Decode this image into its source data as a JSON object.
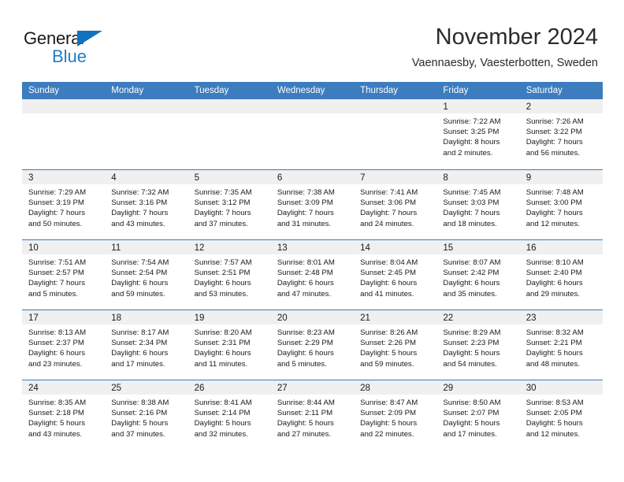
{
  "brand": {
    "word1": "General",
    "word2": "Blue",
    "triangle_color": "#1271bd",
    "word2_color": "#1f7ec4",
    "icon": "triangle-flag-logo"
  },
  "header": {
    "title": "November 2024",
    "subtitle": "Vaennaesby, Vaesterbotten, Sweden"
  },
  "theme": {
    "header_blue": "#3c7cbf",
    "day_band_gray": "#f0f0f0",
    "text_dark": "#1a1a1a"
  },
  "weekdays": [
    "Sunday",
    "Monday",
    "Tuesday",
    "Wednesday",
    "Thursday",
    "Friday",
    "Saturday"
  ],
  "weeks": [
    [
      {
        "day": "",
        "empty": true,
        "lines": []
      },
      {
        "day": "",
        "empty": true,
        "lines": []
      },
      {
        "day": "",
        "empty": true,
        "lines": []
      },
      {
        "day": "",
        "empty": true,
        "lines": []
      },
      {
        "day": "",
        "empty": true,
        "lines": []
      },
      {
        "day": "1",
        "empty": false,
        "lines": [
          "Sunrise: 7:22 AM",
          "Sunset: 3:25 PM",
          "Daylight: 8 hours",
          "and 2 minutes."
        ]
      },
      {
        "day": "2",
        "empty": false,
        "lines": [
          "Sunrise: 7:26 AM",
          "Sunset: 3:22 PM",
          "Daylight: 7 hours",
          "and 56 minutes."
        ]
      }
    ],
    [
      {
        "day": "3",
        "empty": false,
        "lines": [
          "Sunrise: 7:29 AM",
          "Sunset: 3:19 PM",
          "Daylight: 7 hours",
          "and 50 minutes."
        ]
      },
      {
        "day": "4",
        "empty": false,
        "lines": [
          "Sunrise: 7:32 AM",
          "Sunset: 3:16 PM",
          "Daylight: 7 hours",
          "and 43 minutes."
        ]
      },
      {
        "day": "5",
        "empty": false,
        "lines": [
          "Sunrise: 7:35 AM",
          "Sunset: 3:12 PM",
          "Daylight: 7 hours",
          "and 37 minutes."
        ]
      },
      {
        "day": "6",
        "empty": false,
        "lines": [
          "Sunrise: 7:38 AM",
          "Sunset: 3:09 PM",
          "Daylight: 7 hours",
          "and 31 minutes."
        ]
      },
      {
        "day": "7",
        "empty": false,
        "lines": [
          "Sunrise: 7:41 AM",
          "Sunset: 3:06 PM",
          "Daylight: 7 hours",
          "and 24 minutes."
        ]
      },
      {
        "day": "8",
        "empty": false,
        "lines": [
          "Sunrise: 7:45 AM",
          "Sunset: 3:03 PM",
          "Daylight: 7 hours",
          "and 18 minutes."
        ]
      },
      {
        "day": "9",
        "empty": false,
        "lines": [
          "Sunrise: 7:48 AM",
          "Sunset: 3:00 PM",
          "Daylight: 7 hours",
          "and 12 minutes."
        ]
      }
    ],
    [
      {
        "day": "10",
        "empty": false,
        "lines": [
          "Sunrise: 7:51 AM",
          "Sunset: 2:57 PM",
          "Daylight: 7 hours",
          "and 5 minutes."
        ]
      },
      {
        "day": "11",
        "empty": false,
        "lines": [
          "Sunrise: 7:54 AM",
          "Sunset: 2:54 PM",
          "Daylight: 6 hours",
          "and 59 minutes."
        ]
      },
      {
        "day": "12",
        "empty": false,
        "lines": [
          "Sunrise: 7:57 AM",
          "Sunset: 2:51 PM",
          "Daylight: 6 hours",
          "and 53 minutes."
        ]
      },
      {
        "day": "13",
        "empty": false,
        "lines": [
          "Sunrise: 8:01 AM",
          "Sunset: 2:48 PM",
          "Daylight: 6 hours",
          "and 47 minutes."
        ]
      },
      {
        "day": "14",
        "empty": false,
        "lines": [
          "Sunrise: 8:04 AM",
          "Sunset: 2:45 PM",
          "Daylight: 6 hours",
          "and 41 minutes."
        ]
      },
      {
        "day": "15",
        "empty": false,
        "lines": [
          "Sunrise: 8:07 AM",
          "Sunset: 2:42 PM",
          "Daylight: 6 hours",
          "and 35 minutes."
        ]
      },
      {
        "day": "16",
        "empty": false,
        "lines": [
          "Sunrise: 8:10 AM",
          "Sunset: 2:40 PM",
          "Daylight: 6 hours",
          "and 29 minutes."
        ]
      }
    ],
    [
      {
        "day": "17",
        "empty": false,
        "lines": [
          "Sunrise: 8:13 AM",
          "Sunset: 2:37 PM",
          "Daylight: 6 hours",
          "and 23 minutes."
        ]
      },
      {
        "day": "18",
        "empty": false,
        "lines": [
          "Sunrise: 8:17 AM",
          "Sunset: 2:34 PM",
          "Daylight: 6 hours",
          "and 17 minutes."
        ]
      },
      {
        "day": "19",
        "empty": false,
        "lines": [
          "Sunrise: 8:20 AM",
          "Sunset: 2:31 PM",
          "Daylight: 6 hours",
          "and 11 minutes."
        ]
      },
      {
        "day": "20",
        "empty": false,
        "lines": [
          "Sunrise: 8:23 AM",
          "Sunset: 2:29 PM",
          "Daylight: 6 hours",
          "and 5 minutes."
        ]
      },
      {
        "day": "21",
        "empty": false,
        "lines": [
          "Sunrise: 8:26 AM",
          "Sunset: 2:26 PM",
          "Daylight: 5 hours",
          "and 59 minutes."
        ]
      },
      {
        "day": "22",
        "empty": false,
        "lines": [
          "Sunrise: 8:29 AM",
          "Sunset: 2:23 PM",
          "Daylight: 5 hours",
          "and 54 minutes."
        ]
      },
      {
        "day": "23",
        "empty": false,
        "lines": [
          "Sunrise: 8:32 AM",
          "Sunset: 2:21 PM",
          "Daylight: 5 hours",
          "and 48 minutes."
        ]
      }
    ],
    [
      {
        "day": "24",
        "empty": false,
        "lines": [
          "Sunrise: 8:35 AM",
          "Sunset: 2:18 PM",
          "Daylight: 5 hours",
          "and 43 minutes."
        ]
      },
      {
        "day": "25",
        "empty": false,
        "lines": [
          "Sunrise: 8:38 AM",
          "Sunset: 2:16 PM",
          "Daylight: 5 hours",
          "and 37 minutes."
        ]
      },
      {
        "day": "26",
        "empty": false,
        "lines": [
          "Sunrise: 8:41 AM",
          "Sunset: 2:14 PM",
          "Daylight: 5 hours",
          "and 32 minutes."
        ]
      },
      {
        "day": "27",
        "empty": false,
        "lines": [
          "Sunrise: 8:44 AM",
          "Sunset: 2:11 PM",
          "Daylight: 5 hours",
          "and 27 minutes."
        ]
      },
      {
        "day": "28",
        "empty": false,
        "lines": [
          "Sunrise: 8:47 AM",
          "Sunset: 2:09 PM",
          "Daylight: 5 hours",
          "and 22 minutes."
        ]
      },
      {
        "day": "29",
        "empty": false,
        "lines": [
          "Sunrise: 8:50 AM",
          "Sunset: 2:07 PM",
          "Daylight: 5 hours",
          "and 17 minutes."
        ]
      },
      {
        "day": "30",
        "empty": false,
        "lines": [
          "Sunrise: 8:53 AM",
          "Sunset: 2:05 PM",
          "Daylight: 5 hours",
          "and 12 minutes."
        ]
      }
    ]
  ]
}
